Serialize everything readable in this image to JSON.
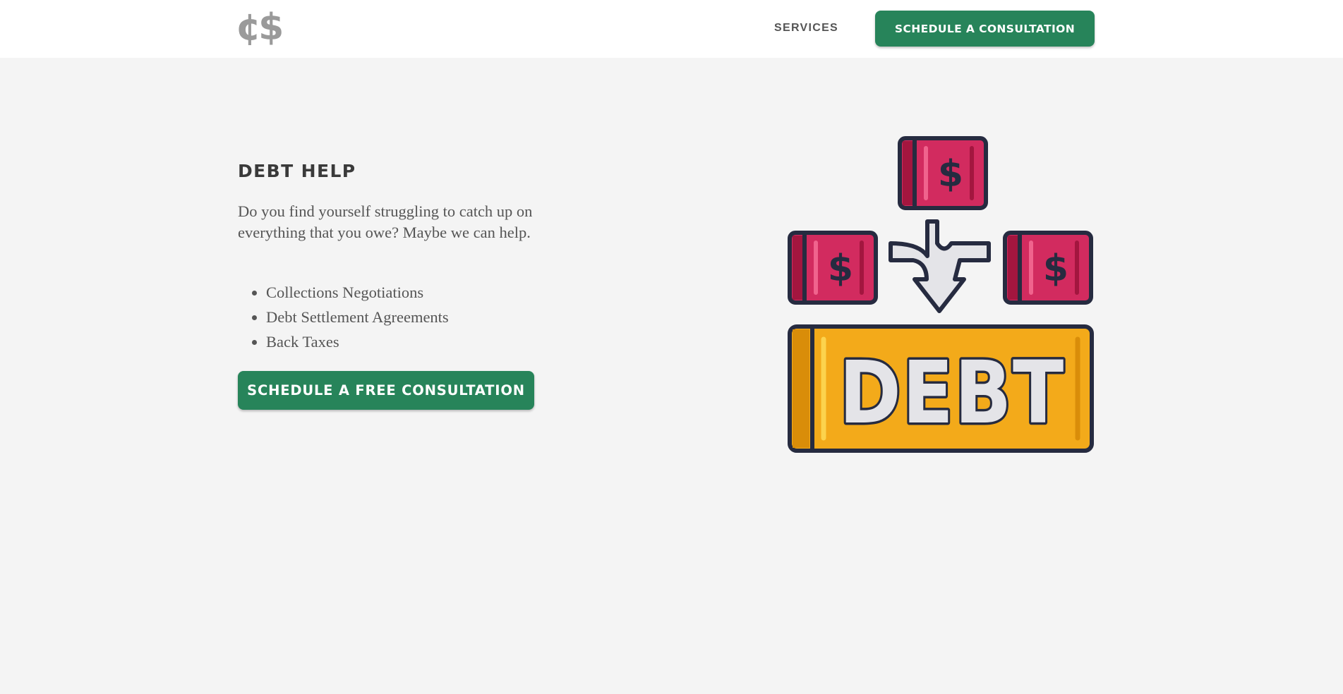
{
  "header": {
    "logo_text": "¢$",
    "nav": {
      "services_label": "SERVICES"
    },
    "cta_label": "SCHEDULE A CONSULTATION"
  },
  "hero": {
    "title": "DEBT HELP",
    "description": "Do you find yourself struggling to catch up on everything that you owe? Maybe we can help.",
    "services": [
      "Collections Negotiations",
      "Debt Settlement Agreements",
      "Back Taxes"
    ],
    "cta_label": "SCHEDULE A FREE CONSULTATION",
    "illustration": {
      "icon": "debt-illustration-icon",
      "text": "DEBT",
      "bill_symbol": "$"
    }
  },
  "colors": {
    "brand_green": "#27845a",
    "page_background": "#f4f4f4",
    "header_background": "#ffffff",
    "logo_gray": "#9a9a9a",
    "outline_navy": "#262b40",
    "bill_pink": "#d22b5f",
    "bill_dark": "#a3163f",
    "bar_gold": "#f3aa1a",
    "bar_dark_gold": "#d98d09",
    "letter_fill": "#e4e4e8"
  }
}
